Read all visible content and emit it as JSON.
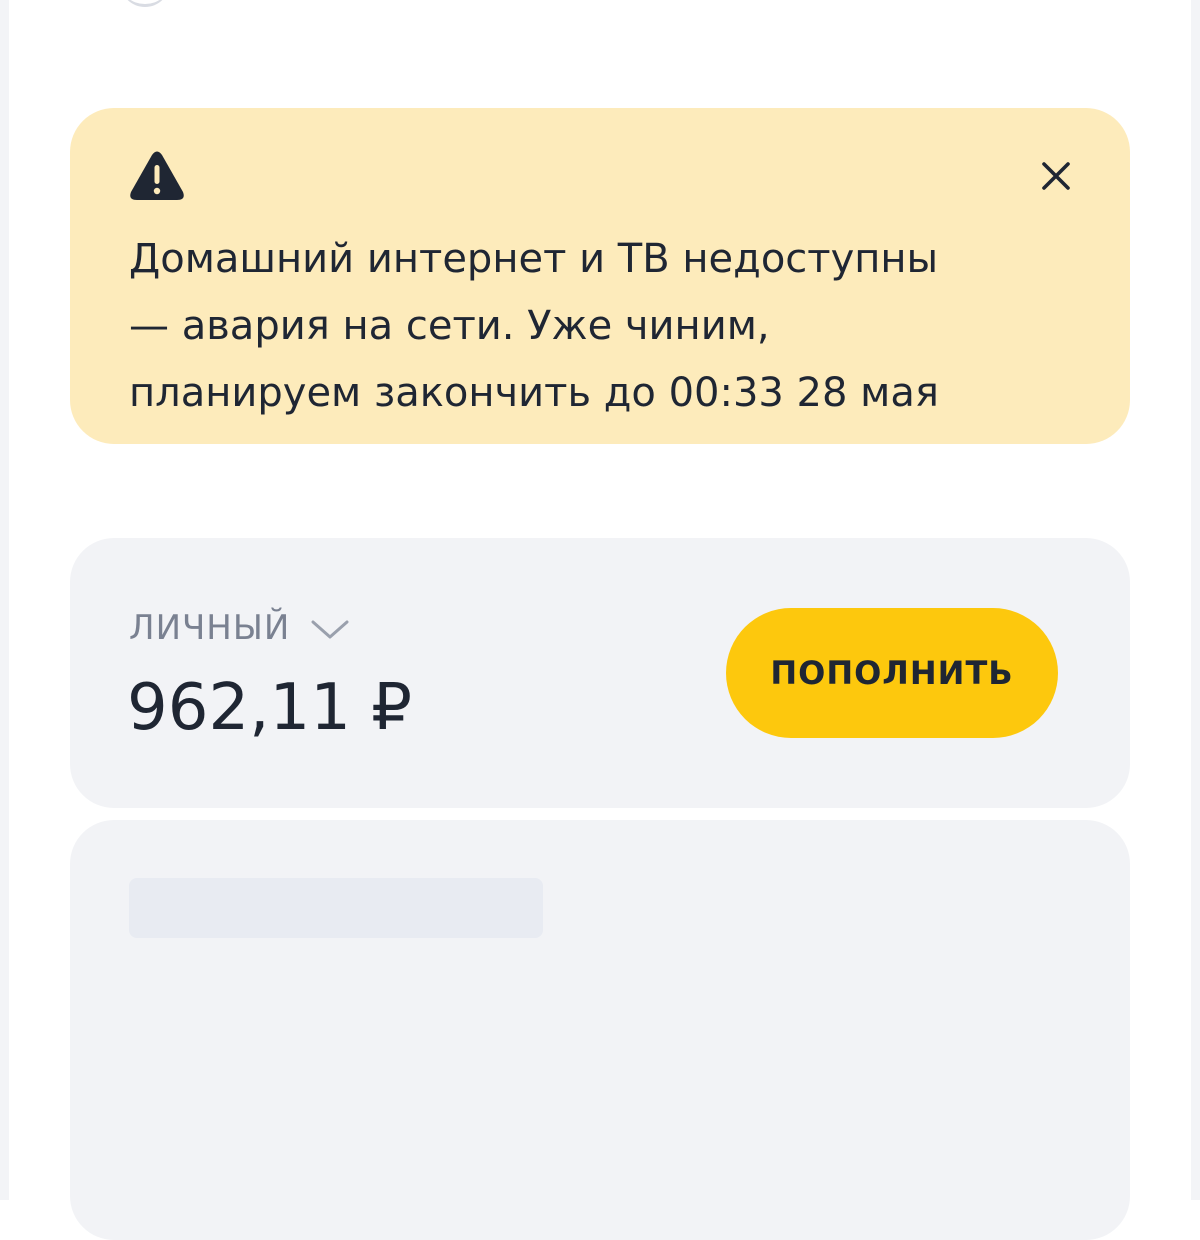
{
  "alert": {
    "icon": "warning-icon",
    "close_icon": "close-icon",
    "message": "Домашний интернет и ТВ недоступны\n— авария на сети. Уже чиним,\nпланируем закончить до 00:33 28 мая",
    "background_color": "#fdebbb"
  },
  "balance": {
    "account_label": "ЛИЧНЫЙ",
    "chevron_icon": "chevron-down-icon",
    "amount": "962,11 ₽",
    "topup_label": "ПОПОЛНИТЬ",
    "accent_color": "#fdc80d"
  },
  "services": {
    "state": "loading"
  }
}
